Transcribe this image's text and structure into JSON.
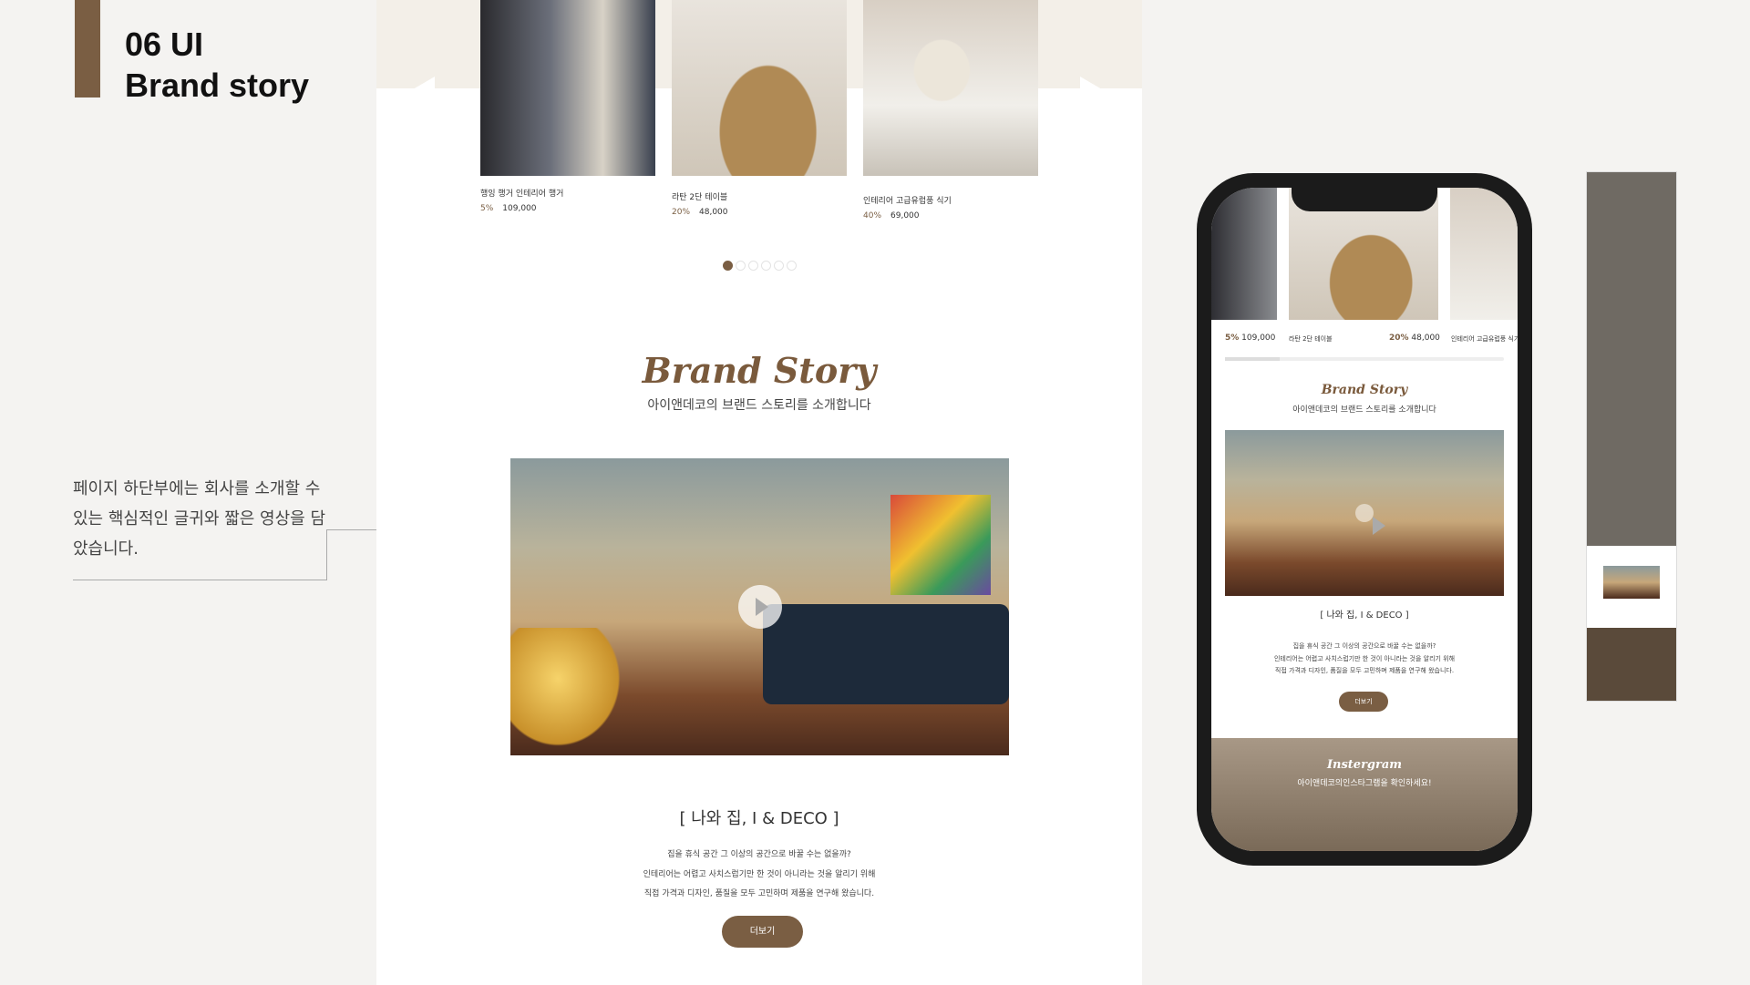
{
  "section": {
    "number_title": "06 UI",
    "name": "Brand story"
  },
  "description": "페이지 하단부에는 회사를 소개할 수 있는 핵심적인 글귀와 짧은 영상을 담았습니다.",
  "colors": {
    "accent": "#7a5e43",
    "band": "#f3efe8"
  },
  "products": [
    {
      "name": "행잉 행거 인테리어 행거",
      "discount": "5%",
      "price": "109,000"
    },
    {
      "name": "라탄 2단 테이블",
      "discount": "20%",
      "price": "48,000"
    },
    {
      "name": "인테리어 고급유럽풍 식기",
      "discount": "40%",
      "price": "69,000"
    }
  ],
  "slider": {
    "total_dots": 6,
    "active": 1,
    "prev_icon": "arrow-left-icon",
    "next_icon": "arrow-right-icon"
  },
  "brand": {
    "title": "Brand Story",
    "subtitle": "아이앤데코의 브랜드 스토리를 소개합니다",
    "heading": "[ 나와 집, I & DECO ]",
    "lines": [
      "집을 휴식 공간 그 이상의 공간으로 바꿀 수는 없을까?",
      "인테리어는 어렵고 사치스럽기만 한 것이 아니라는 것을 알리기 위해",
      "직접 가격과 디자인, 품질을 모두 고민하며 제품을 연구해 왔습니다."
    ],
    "more": "더보기",
    "play_icon": "play-icon"
  },
  "mobile": {
    "products": [
      {
        "discount": "5%",
        "price": "109,000"
      },
      {
        "name": "라탄 2단 테이블",
        "discount": "20%",
        "price": "48,000"
      },
      {
        "name": "인테리어 고급유럽풍 식기"
      }
    ],
    "instagram_title": "Instergram",
    "instagram_sub": "아이앤데코의인스타그램을 확인하세요!"
  }
}
